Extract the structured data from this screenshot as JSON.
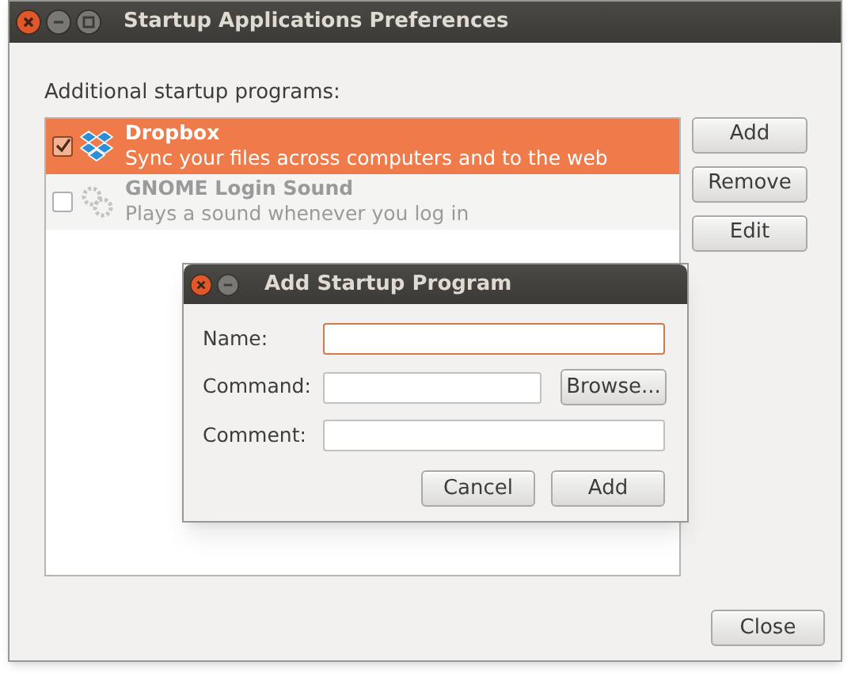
{
  "window": {
    "title": "Startup Applications Preferences"
  },
  "list_label": "Additional startup programs:",
  "programs": [
    {
      "name": "Dropbox",
      "description": "Sync your files across computers and to the web",
      "checked": true,
      "selected": true,
      "kind": "box"
    },
    {
      "name": "GNOME Login Sound",
      "description": "Plays a sound whenever you log in",
      "checked": false,
      "selected": false,
      "kind": "gears"
    }
  ],
  "side_buttons": [
    "Add",
    "Remove",
    "Edit"
  ],
  "close_button": "Close",
  "dialog": {
    "title": "Add Startup Program",
    "fields": [
      {
        "label": "Name:",
        "focused": true,
        "kind": "plain"
      },
      {
        "label": "Command:",
        "focused": false,
        "kind": "browse",
        "button": "Browse..."
      },
      {
        "label": "Comment:",
        "focused": false,
        "kind": "plain"
      }
    ],
    "buttons": [
      "Cancel",
      "Add"
    ]
  }
}
